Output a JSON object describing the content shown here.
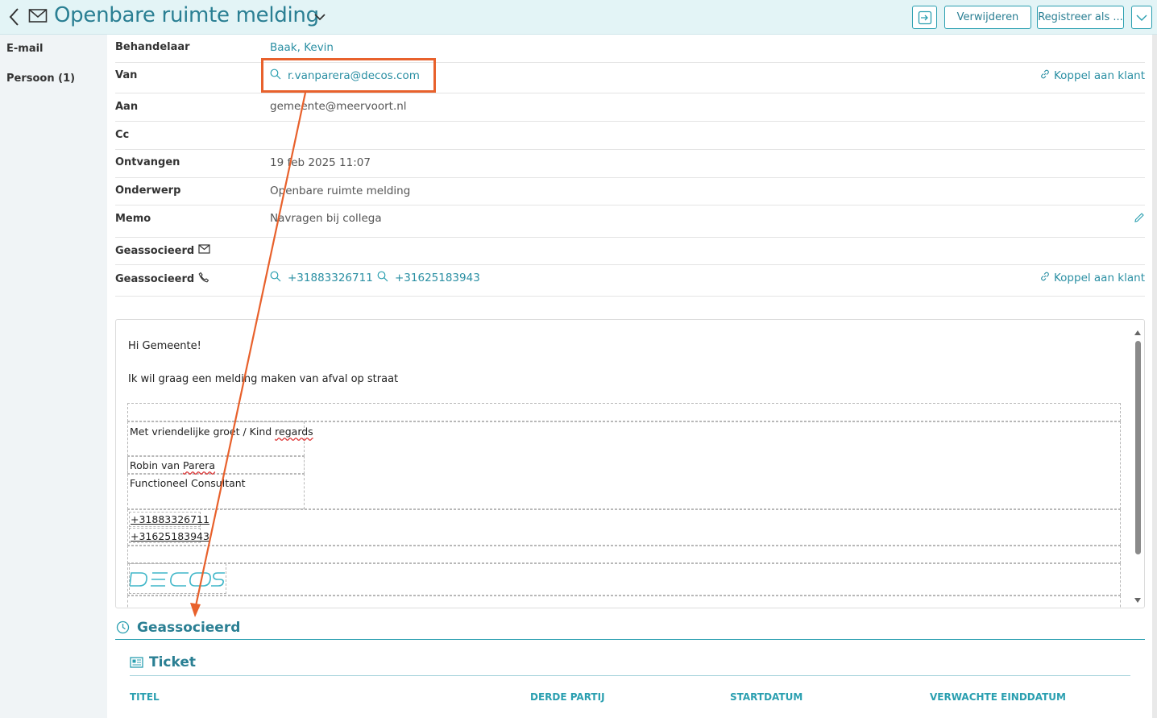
{
  "header": {
    "title": "Openbare ruimte melding",
    "delete_label": "Verwijderen",
    "register_label": "Registreer als ..."
  },
  "sidebar": {
    "items": [
      {
        "label": "E-mail"
      },
      {
        "label": "Persoon (1)"
      }
    ]
  },
  "details": {
    "handler_label": "Behandelaar",
    "handler_value": "Baak, Kevin",
    "from_label": "Van",
    "from_value": "r.vanparera@decos.com",
    "link_customer_label": "Koppel aan klant",
    "to_label": "Aan",
    "to_value": "gemeente@meervoort.nl",
    "cc_label": "Cc",
    "cc_value": "",
    "received_label": "Ontvangen",
    "received_value": "19 feb 2025 11:07",
    "subject_label": "Onderwerp",
    "subject_value": "Openbare ruimte melding",
    "memo_label": "Memo",
    "memo_value": "Navragen bij collega",
    "assoc_mail_label": "Geassocieerd",
    "assoc_phone_label": "Geassocieerd",
    "phones": [
      "+31883326711",
      "+31625183943"
    ]
  },
  "email_body": {
    "greeting": "Hi Gemeente!",
    "message": "Ik wil graag een melding maken van afval op straat",
    "signature_greeting_prefix": "Met vriendelijke groet / Kind ",
    "signature_greeting_suffix": "regards",
    "signature_name_prefix": "Robin van ",
    "signature_name_suffix": "Parera",
    "signature_role": "Functioneel Consultant",
    "signature_phone1": "+31883326711",
    "signature_phone2": "+31625183943",
    "logo_text": "DECOS"
  },
  "associated": {
    "title": "Geassocieerd",
    "ticket_title": "Ticket",
    "columns": [
      "TITEL",
      "DERDE PARTIJ",
      "STARTDATUM",
      "VERWACHTE EINDDATUM"
    ]
  },
  "colors": {
    "accent": "#2a8fa3",
    "header_bg": "#e3f4f6",
    "annotation": "#e8612c"
  }
}
